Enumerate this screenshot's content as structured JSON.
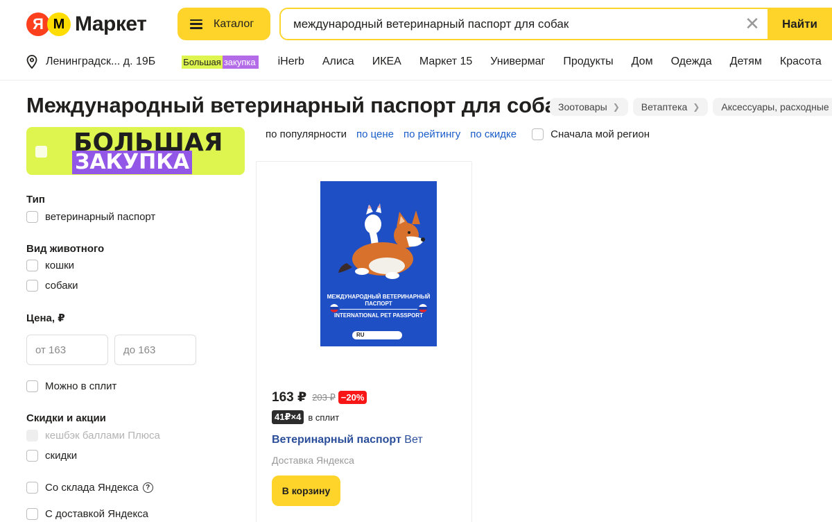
{
  "header": {
    "logo_ya": "Я",
    "logo_text": "Маркет",
    "catalog_label": "Каталог",
    "search_value": "международный ветеринарный паспорт для собак",
    "search_button": "Найти"
  },
  "subnav": {
    "address": "Ленинградск... д. 19Б",
    "promo_part1": "Большая",
    "promo_part2": "закупка",
    "links": [
      "iHerb",
      "Алиса",
      "ИКЕА",
      "Маркет 15",
      "Универмаг",
      "Продукты",
      "Дом",
      "Одежда",
      "Детям",
      "Красота"
    ]
  },
  "page": {
    "title": "Международный ветеринарный паспорт для собак",
    "breadcrumbs": [
      "Зоотовары",
      "Ветаптека",
      "Аксессуары, расходные м"
    ]
  },
  "banner": {
    "line1": "БОЛЬШАЯ",
    "line2": "ЗАКУПКА"
  },
  "sort": {
    "options": [
      "по популярности",
      "по цене",
      "по рейтингу",
      "по скидке"
    ],
    "region_label": "Сначала мой регион"
  },
  "filters": {
    "type_title": "Тип",
    "type_opt": "ветеринарный паспорт",
    "animal_title": "Вид животного",
    "animal_opt1": "кошки",
    "animal_opt2": "собаки",
    "price_title": "Цена, ₽",
    "price_from": "от 163",
    "price_to": "до 163",
    "split_label": "Можно в сплит",
    "promo_title": "Скидки и акции",
    "cashback": "кешбэк баллами Плюса",
    "discounts": "скидки",
    "warehouse": "Со склада Яндекса",
    "yandex_delivery": "С доставкой Яндекса"
  },
  "product": {
    "image_text_ru": "МЕЖДУНАРОДНЫЙ ВЕТЕРИНАРНЫЙ ПАСПОРТ",
    "image_text_en": "INTERNATIONAL PET PASSPORT",
    "image_ru": "RU",
    "price": "163 ₽",
    "old_price": "203 ₽",
    "discount": "−20%",
    "split_tag": "41₽×4",
    "split_text": "в сплит",
    "title_bold": "Ветеринарный паспорт",
    "title_rest": "Вет",
    "delivery": "Доставка Яндекса",
    "cart_button": "В корзину"
  },
  "colors": {
    "accent_yellow": "#fed42b",
    "promo_green": "#ddf54e",
    "promo_purple": "#9257e6",
    "link_blue": "#1a5dc9",
    "discount_red": "#f81616",
    "passport_blue": "#1f4fc4"
  },
  "icons": [
    "location-pin-icon",
    "burger-icon",
    "close-icon",
    "chevron-right-icon",
    "question-icon"
  ]
}
